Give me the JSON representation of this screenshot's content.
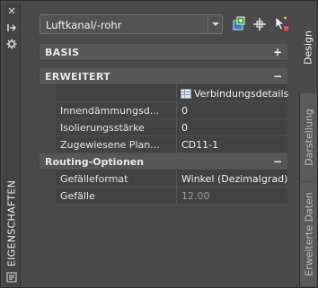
{
  "palette": {
    "title": "EIGENSCHAFTEN",
    "strip_icons": [
      "close-icon",
      "pin-icon",
      "settings-icon",
      "properties-icon"
    ]
  },
  "combo": {
    "value": "Luftkanal/-rohr"
  },
  "toolbar": {
    "icons": [
      "add-style-icon",
      "select-objects-icon",
      "quick-select-icon"
    ]
  },
  "grid": {
    "basis": {
      "label": "BASIS",
      "toggle": "+"
    },
    "erweitert": {
      "label": "ERWEITERT",
      "toggle": "−",
      "detail_link": "Verbindungsdetails",
      "rows": [
        {
          "name": "Innendämmungsd...",
          "value": "0"
        },
        {
          "name": "Isolierungsstärke",
          "value": "0"
        },
        {
          "name": "Zugewiesene Plan...",
          "value": "CD11-1"
        }
      ]
    },
    "routing": {
      "label": "Routing-Optionen",
      "toggle": "−",
      "rows": [
        {
          "name": "Gefälleformat",
          "value": "Winkel (Dezimalgrad)"
        },
        {
          "name": "Gefälle",
          "value": "12.00"
        }
      ]
    }
  },
  "tabs": {
    "design": "Design",
    "darstellung": "Darstellung",
    "erweiterte_daten": "Erweiterte Daten"
  },
  "colors": {
    "background": "#4a4a4a",
    "category_header": "#565656",
    "row_fill": "#424242",
    "disabled_text": "#9a9a9a"
  }
}
